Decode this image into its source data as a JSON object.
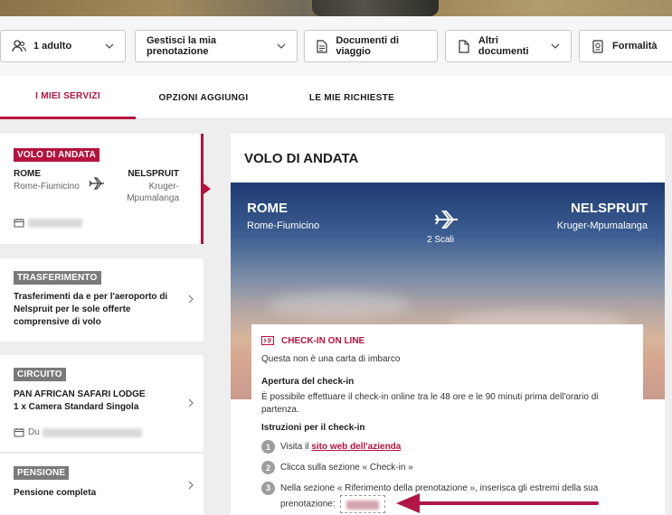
{
  "toolbar": {
    "passengers": "1 adulto",
    "manage_booking": "Gestisci la mia prenotazione",
    "travel_docs": "Documenti di viaggio",
    "other_docs": "Altri documenti",
    "formalities": "Formalità"
  },
  "tabs": [
    {
      "label": "I MIEI SERVIZI"
    },
    {
      "label": "OPZIONI AGGIUNGI"
    },
    {
      "label": "LE MIE RICHIESTE"
    }
  ],
  "sidebar": {
    "outbound": {
      "badge": "VOLO DI ANDATA",
      "from_code": "ROME",
      "from_airport": "Rome-Fiumicino",
      "to_code": "NELSPRUIT",
      "to_airport_line1": "Kruger-",
      "to_airport_line2": "Mpumalanga"
    },
    "transfer": {
      "badge": "TRASFERIMENTO",
      "text_l1": "Trasferimenti da e per l'aeroporto di",
      "text_l2": "Nelspruit per le sole offerte",
      "text_l3": "comprensive di volo"
    },
    "circuit": {
      "badge": "CIRCUITO",
      "title": "PAN AFRICAN SAFARI LODGE",
      "room": "1 x Camera Standard Singola",
      "date_prefix": "Du"
    },
    "board": {
      "badge": "PENSIONE",
      "text": "Pensione completa"
    }
  },
  "main": {
    "title": "VOLO DI ANDATA",
    "from_code": "ROME",
    "from_airport": "Rome-Fiumicino",
    "to_code": "NELSPRUIT",
    "to_airport": "Kruger-Mpumalanga",
    "stops": "2 Scali",
    "checkin": {
      "header": "CHECK-IN ON LINE",
      "note": "Questa non è una carta di imbarco",
      "opening_title": "Apertura del check-in",
      "opening_l1": "È possibile effettuare il check-in online tra le 48 ore e le 90 minuti prima dell'orario di",
      "opening_l2": "partenza.",
      "instructions_title": "Istruzioni per il check-in",
      "step1_prefix": "Visita il",
      "step1_link": "sito web dell'azienda",
      "step2": "Clicca sulla sezione « Check-in »",
      "step3_l1": "Nella sezione « Riferimento della prenotazione », inserisca gli estremi della sua",
      "step3_l2": "prenotazione:"
    }
  },
  "colors": {
    "accent": "#b5123e",
    "badge_grey": "#7a7a7a"
  }
}
